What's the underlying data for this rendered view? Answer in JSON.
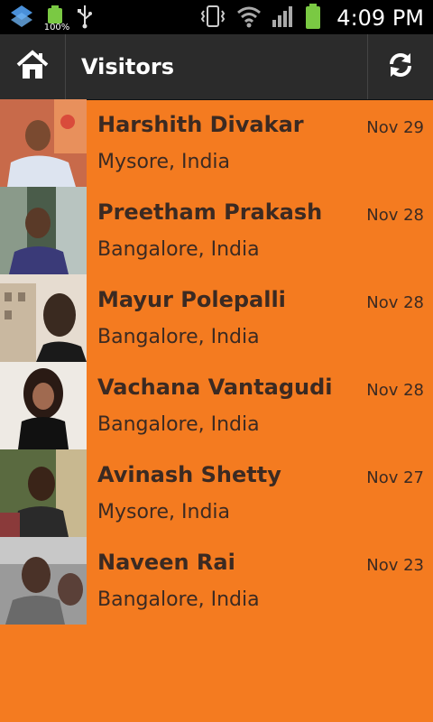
{
  "status_bar": {
    "time": "4:09 PM",
    "battery_percent_label": "100%",
    "icons": [
      "dropbox-icon",
      "battery-small-icon",
      "usb-icon",
      "vibrate-icon",
      "wifi-icon",
      "signal-icon",
      "battery-icon"
    ]
  },
  "action_bar": {
    "title": "Visitors",
    "home_icon": "home-icon",
    "refresh_icon": "refresh-icon"
  },
  "visitors": [
    {
      "name": "Harshith Divakar",
      "location": "Mysore, India",
      "date": "Nov 29"
    },
    {
      "name": "Preetham Prakash",
      "location": "Bangalore, India",
      "date": "Nov 28"
    },
    {
      "name": "Mayur Polepalli",
      "location": "Bangalore, India",
      "date": "Nov 28"
    },
    {
      "name": "Vachana Vantagudi",
      "location": "Bangalore, India",
      "date": "Nov 28"
    },
    {
      "name": "Avinash Shetty",
      "location": "Mysore, India",
      "date": "Nov 27"
    },
    {
      "name": "Naveen Rai",
      "location": "Bangalore, India",
      "date": "Nov 23"
    }
  ],
  "colors": {
    "background": "#f47b20",
    "action_bar": "#2b2b2b",
    "text": "#3b2a22"
  }
}
